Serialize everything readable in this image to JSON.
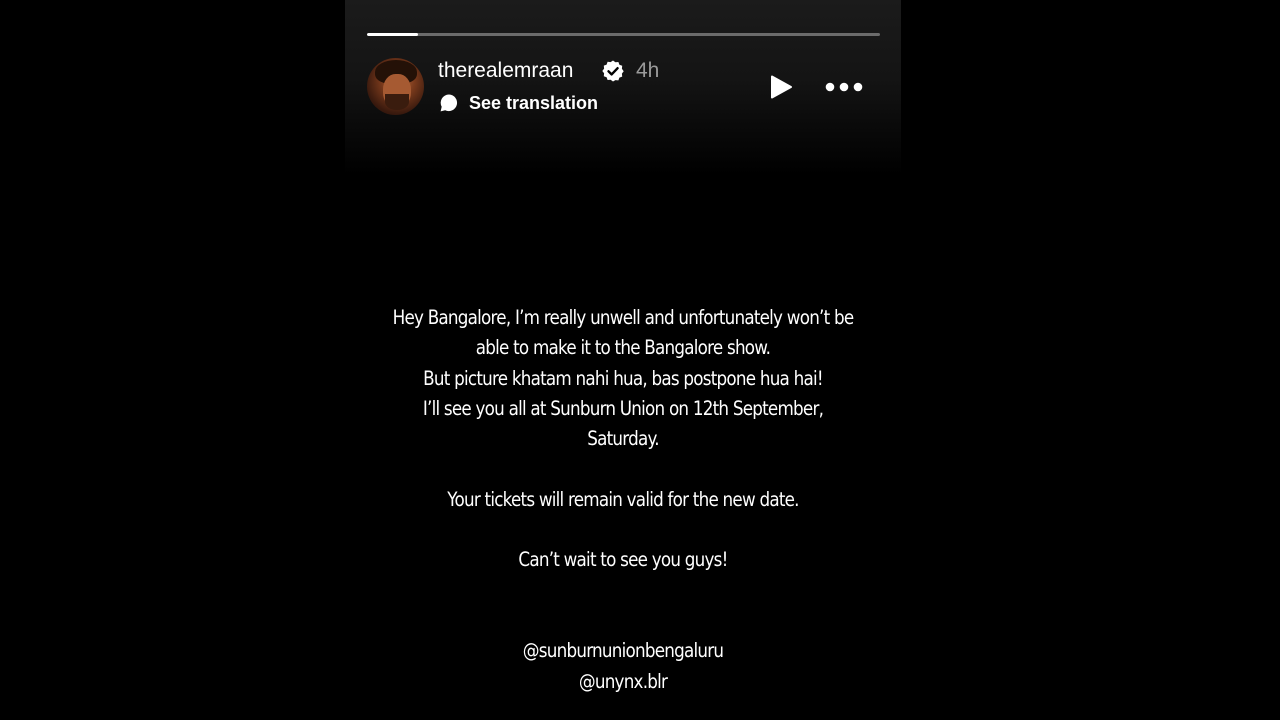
{
  "story": {
    "progress": 0.1,
    "username": "therealemraan",
    "verified": true,
    "time_ago": "4h",
    "translate_label": "See translation",
    "icons": {
      "avatar": "profile-avatar",
      "verified": "verified-badge-icon",
      "translate": "translate-bubble-icon",
      "play": "play-icon",
      "more": "more-options-icon"
    },
    "colors": {
      "background": "#000000",
      "text": "#ffffff",
      "muted": "#9a9a9a",
      "progress_track": "#6b6b6b"
    }
  },
  "message": {
    "lines_block1": [
      "Hey Bangalore, I’m really unwell and unfortunately won’t be",
      "able to make it to the Bangalore show.",
      "But picture khatam nahi hua, bas postpone hua hai!",
      "I’ll see you all at Sunburn Union on 12th September,",
      "Saturday."
    ],
    "line_tickets": "Your tickets will remain valid for the new date.",
    "line_wait": "Can’t wait to see you guys!",
    "mentions": [
      "@sunburnunionbengaluru",
      "@unynx.blr"
    ]
  }
}
